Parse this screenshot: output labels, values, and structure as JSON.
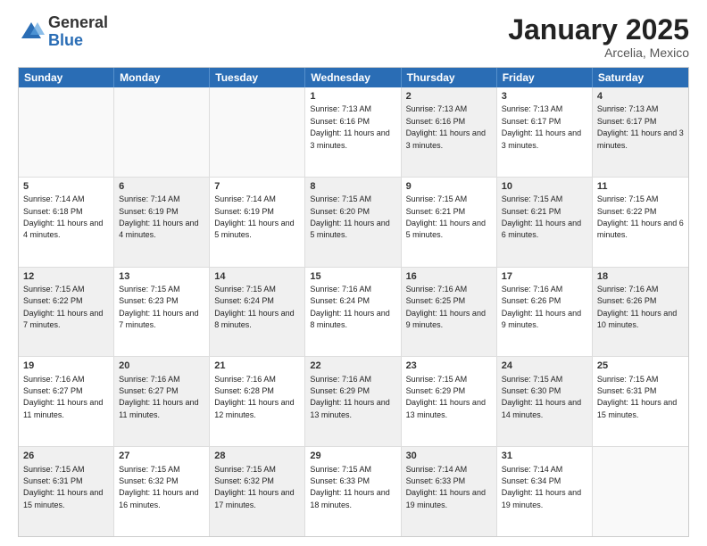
{
  "header": {
    "logo_general": "General",
    "logo_blue": "Blue",
    "title": "January 2025",
    "location": "Arcelia, Mexico"
  },
  "days": [
    "Sunday",
    "Monday",
    "Tuesday",
    "Wednesday",
    "Thursday",
    "Friday",
    "Saturday"
  ],
  "weeks": [
    [
      {
        "day": "",
        "text": "",
        "empty": true
      },
      {
        "day": "",
        "text": "",
        "empty": true
      },
      {
        "day": "",
        "text": "",
        "empty": true
      },
      {
        "day": "1",
        "text": "Sunrise: 7:13 AM\nSunset: 6:16 PM\nDaylight: 11 hours and 3 minutes.",
        "shaded": false
      },
      {
        "day": "2",
        "text": "Sunrise: 7:13 AM\nSunset: 6:16 PM\nDaylight: 11 hours and 3 minutes.",
        "shaded": true
      },
      {
        "day": "3",
        "text": "Sunrise: 7:13 AM\nSunset: 6:17 PM\nDaylight: 11 hours and 3 minutes.",
        "shaded": false
      },
      {
        "day": "4",
        "text": "Sunrise: 7:13 AM\nSunset: 6:17 PM\nDaylight: 11 hours and 3 minutes.",
        "shaded": true
      }
    ],
    [
      {
        "day": "5",
        "text": "Sunrise: 7:14 AM\nSunset: 6:18 PM\nDaylight: 11 hours and 4 minutes.",
        "shaded": false
      },
      {
        "day": "6",
        "text": "Sunrise: 7:14 AM\nSunset: 6:19 PM\nDaylight: 11 hours and 4 minutes.",
        "shaded": true
      },
      {
        "day": "7",
        "text": "Sunrise: 7:14 AM\nSunset: 6:19 PM\nDaylight: 11 hours and 5 minutes.",
        "shaded": false
      },
      {
        "day": "8",
        "text": "Sunrise: 7:15 AM\nSunset: 6:20 PM\nDaylight: 11 hours and 5 minutes.",
        "shaded": true
      },
      {
        "day": "9",
        "text": "Sunrise: 7:15 AM\nSunset: 6:21 PM\nDaylight: 11 hours and 5 minutes.",
        "shaded": false
      },
      {
        "day": "10",
        "text": "Sunrise: 7:15 AM\nSunset: 6:21 PM\nDaylight: 11 hours and 6 minutes.",
        "shaded": true
      },
      {
        "day": "11",
        "text": "Sunrise: 7:15 AM\nSunset: 6:22 PM\nDaylight: 11 hours and 6 minutes.",
        "shaded": false
      }
    ],
    [
      {
        "day": "12",
        "text": "Sunrise: 7:15 AM\nSunset: 6:22 PM\nDaylight: 11 hours and 7 minutes.",
        "shaded": true
      },
      {
        "day": "13",
        "text": "Sunrise: 7:15 AM\nSunset: 6:23 PM\nDaylight: 11 hours and 7 minutes.",
        "shaded": false
      },
      {
        "day": "14",
        "text": "Sunrise: 7:15 AM\nSunset: 6:24 PM\nDaylight: 11 hours and 8 minutes.",
        "shaded": true
      },
      {
        "day": "15",
        "text": "Sunrise: 7:16 AM\nSunset: 6:24 PM\nDaylight: 11 hours and 8 minutes.",
        "shaded": false
      },
      {
        "day": "16",
        "text": "Sunrise: 7:16 AM\nSunset: 6:25 PM\nDaylight: 11 hours and 9 minutes.",
        "shaded": true
      },
      {
        "day": "17",
        "text": "Sunrise: 7:16 AM\nSunset: 6:26 PM\nDaylight: 11 hours and 9 minutes.",
        "shaded": false
      },
      {
        "day": "18",
        "text": "Sunrise: 7:16 AM\nSunset: 6:26 PM\nDaylight: 11 hours and 10 minutes.",
        "shaded": true
      }
    ],
    [
      {
        "day": "19",
        "text": "Sunrise: 7:16 AM\nSunset: 6:27 PM\nDaylight: 11 hours and 11 minutes.",
        "shaded": false
      },
      {
        "day": "20",
        "text": "Sunrise: 7:16 AM\nSunset: 6:27 PM\nDaylight: 11 hours and 11 minutes.",
        "shaded": true
      },
      {
        "day": "21",
        "text": "Sunrise: 7:16 AM\nSunset: 6:28 PM\nDaylight: 11 hours and 12 minutes.",
        "shaded": false
      },
      {
        "day": "22",
        "text": "Sunrise: 7:16 AM\nSunset: 6:29 PM\nDaylight: 11 hours and 13 minutes.",
        "shaded": true
      },
      {
        "day": "23",
        "text": "Sunrise: 7:15 AM\nSunset: 6:29 PM\nDaylight: 11 hours and 13 minutes.",
        "shaded": false
      },
      {
        "day": "24",
        "text": "Sunrise: 7:15 AM\nSunset: 6:30 PM\nDaylight: 11 hours and 14 minutes.",
        "shaded": true
      },
      {
        "day": "25",
        "text": "Sunrise: 7:15 AM\nSunset: 6:31 PM\nDaylight: 11 hours and 15 minutes.",
        "shaded": false
      }
    ],
    [
      {
        "day": "26",
        "text": "Sunrise: 7:15 AM\nSunset: 6:31 PM\nDaylight: 11 hours and 15 minutes.",
        "shaded": true
      },
      {
        "day": "27",
        "text": "Sunrise: 7:15 AM\nSunset: 6:32 PM\nDaylight: 11 hours and 16 minutes.",
        "shaded": false
      },
      {
        "day": "28",
        "text": "Sunrise: 7:15 AM\nSunset: 6:32 PM\nDaylight: 11 hours and 17 minutes.",
        "shaded": true
      },
      {
        "day": "29",
        "text": "Sunrise: 7:15 AM\nSunset: 6:33 PM\nDaylight: 11 hours and 18 minutes.",
        "shaded": false
      },
      {
        "day": "30",
        "text": "Sunrise: 7:14 AM\nSunset: 6:33 PM\nDaylight: 11 hours and 19 minutes.",
        "shaded": true
      },
      {
        "day": "31",
        "text": "Sunrise: 7:14 AM\nSunset: 6:34 PM\nDaylight: 11 hours and 19 minutes.",
        "shaded": false
      },
      {
        "day": "",
        "text": "",
        "empty": true
      }
    ]
  ],
  "colors": {
    "header_bg": "#2a6db5",
    "shaded_bg": "#f0f0f0",
    "empty_bg": "#f9f9f9"
  }
}
